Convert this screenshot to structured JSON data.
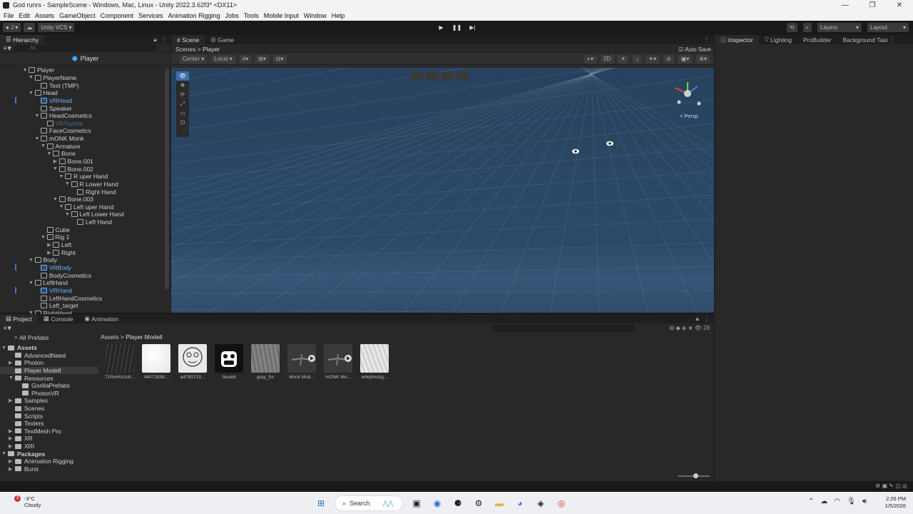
{
  "window": {
    "title": "God runrs - SampleScene - Windows, Mac, Linux - Unity 2022.3.62f3* <DX11>"
  },
  "menu": [
    "File",
    "Edit",
    "Assets",
    "GameObject",
    "Component",
    "Services",
    "Animation Rigging",
    "Jobs",
    "Tools",
    "Mobile Input",
    "Window",
    "Help"
  ],
  "toolbar": {
    "account": "J",
    "vcs": "Unity VCS",
    "layers": "Layers",
    "layout": "Layout"
  },
  "hierarchy": {
    "tab": "Hierarchy",
    "search_placeholder": "All",
    "context": "Player",
    "items": [
      {
        "label": "Player",
        "depth": 0,
        "arrow": "▼",
        "style": ""
      },
      {
        "label": "PlayerName",
        "depth": 1,
        "arrow": "▼",
        "style": ""
      },
      {
        "label": "Text (TMP)",
        "depth": 2,
        "arrow": "",
        "style": ""
      },
      {
        "label": "Head",
        "depth": 1,
        "arrow": "▼",
        "style": ""
      },
      {
        "label": "VRHead",
        "depth": 2,
        "arrow": "",
        "style": "blue"
      },
      {
        "label": "Speaker",
        "depth": 2,
        "arrow": "",
        "style": ""
      },
      {
        "label": "HeadCosmetics",
        "depth": 2,
        "arrow": "▼",
        "style": ""
      },
      {
        "label": "VRTopHat",
        "depth": 3,
        "arrow": "",
        "style": "dim"
      },
      {
        "label": "FaceCosmetics",
        "depth": 2,
        "arrow": "",
        "style": ""
      },
      {
        "label": "mONK Monk",
        "depth": 2,
        "arrow": "▼",
        "style": ""
      },
      {
        "label": "Armature",
        "depth": 3,
        "arrow": "▼",
        "style": ""
      },
      {
        "label": "Bone",
        "depth": 4,
        "arrow": "▼",
        "style": ""
      },
      {
        "label": "Bone.001",
        "depth": 5,
        "arrow": "▶",
        "style": ""
      },
      {
        "label": "Bone.002",
        "depth": 5,
        "arrow": "▼",
        "style": ""
      },
      {
        "label": "R uper Hand",
        "depth": 6,
        "arrow": "▼",
        "style": ""
      },
      {
        "label": "R Lower Hand",
        "depth": 7,
        "arrow": "▼",
        "style": ""
      },
      {
        "label": "Right Hand",
        "depth": 8,
        "arrow": "",
        "style": ""
      },
      {
        "label": "Bone.003",
        "depth": 5,
        "arrow": "▼",
        "style": ""
      },
      {
        "label": "Left uper Hand",
        "depth": 6,
        "arrow": "▼",
        "style": ""
      },
      {
        "label": "Left Lower Hand",
        "depth": 7,
        "arrow": "▼",
        "style": ""
      },
      {
        "label": "Left Hand",
        "depth": 8,
        "arrow": "",
        "style": ""
      },
      {
        "label": "Cube",
        "depth": 3,
        "arrow": "",
        "style": ""
      },
      {
        "label": "Rig 1",
        "depth": 3,
        "arrow": "▼",
        "style": ""
      },
      {
        "label": "Left",
        "depth": 4,
        "arrow": "▶",
        "style": ""
      },
      {
        "label": "Right",
        "depth": 4,
        "arrow": "▶",
        "style": ""
      },
      {
        "label": "Body",
        "depth": 1,
        "arrow": "▼",
        "style": ""
      },
      {
        "label": "VRBody",
        "depth": 2,
        "arrow": "",
        "style": "blue"
      },
      {
        "label": "BodyCosmetics",
        "depth": 2,
        "arrow": "",
        "style": ""
      },
      {
        "label": "LeftHand",
        "depth": 1,
        "arrow": "▼",
        "style": ""
      },
      {
        "label": "VRHand",
        "depth": 2,
        "arrow": "",
        "style": "blue"
      },
      {
        "label": "LeftHandCosmetics",
        "depth": 2,
        "arrow": "",
        "style": ""
      },
      {
        "label": "Left_target",
        "depth": 2,
        "arrow": "",
        "style": ""
      },
      {
        "label": "RightHand",
        "depth": 1,
        "arrow": "▼",
        "style": ""
      }
    ]
  },
  "scene": {
    "tabs": [
      "Scene",
      "Game"
    ],
    "breadcrumb": {
      "root": "Scenes",
      "current": "Player"
    },
    "auto_save": "Auto Save",
    "pivot": "Center",
    "space": "Local",
    "mode_2d": "2D",
    "persp": "< Persp"
  },
  "inspector": {
    "tabs": [
      "Inspector",
      "Lighting",
      "ProBuilder",
      "Background Tasi"
    ]
  },
  "project": {
    "tabs": [
      "Project",
      "Console",
      "Animation"
    ],
    "favorites": "All Prefabs",
    "count": "28",
    "breadcrumb": {
      "root": "Assets",
      "current": "Player Modell"
    },
    "tree": [
      {
        "label": "Assets",
        "depth": 0,
        "bold": true,
        "sel": false,
        "arrow": "▼"
      },
      {
        "label": "AdvancedNeed",
        "depth": 1,
        "bold": false,
        "sel": false,
        "arrow": ""
      },
      {
        "label": "Photon",
        "depth": 1,
        "bold": false,
        "sel": false,
        "arrow": "▶"
      },
      {
        "label": "Player Modell",
        "depth": 1,
        "bold": false,
        "sel": true,
        "arrow": ""
      },
      {
        "label": "Resources",
        "depth": 1,
        "bold": false,
        "sel": false,
        "arrow": "▼"
      },
      {
        "label": "GorillaPrefabs",
        "depth": 2,
        "bold": false,
        "sel": false,
        "arrow": ""
      },
      {
        "label": "PhotonVR",
        "depth": 2,
        "bold": false,
        "sel": false,
        "arrow": ""
      },
      {
        "label": "Samples",
        "depth": 1,
        "bold": false,
        "sel": false,
        "arrow": "▶"
      },
      {
        "label": "Scenes",
        "depth": 1,
        "bold": false,
        "sel": false,
        "arrow": ""
      },
      {
        "label": "Scripts",
        "depth": 1,
        "bold": false,
        "sel": false,
        "arrow": ""
      },
      {
        "label": "Texters",
        "depth": 1,
        "bold": false,
        "sel": false,
        "arrow": ""
      },
      {
        "label": "TextMesh Pro",
        "depth": 1,
        "bold": false,
        "sel": false,
        "arrow": "▶"
      },
      {
        "label": "XR",
        "depth": 1,
        "bold": false,
        "sel": false,
        "arrow": "▶"
      },
      {
        "label": "XRI",
        "depth": 1,
        "bold": false,
        "sel": false,
        "arrow": "▶"
      },
      {
        "label": "Packages",
        "depth": 0,
        "bold": true,
        "sel": false,
        "arrow": "▼"
      },
      {
        "label": "Animation Rigging",
        "depth": 1,
        "bold": false,
        "sel": false,
        "arrow": "▶"
      },
      {
        "label": "Burst",
        "depth": 1,
        "bold": false,
        "sel": false,
        "arrow": "▶"
      }
    ],
    "assets": [
      {
        "label": "71RwHzUo9...",
        "kind": "fur-dark"
      },
      {
        "label": "4407283d...",
        "kind": "white"
      },
      {
        "label": "a4790713...",
        "kind": "face"
      },
      {
        "label": "faceblt",
        "kind": "monkey"
      },
      {
        "label": "gray_fur",
        "kind": "fur-gray"
      },
      {
        "label": "Monk Mod...",
        "kind": "model"
      },
      {
        "label": "mONK Mo...",
        "kind": "model"
      },
      {
        "label": "w4ejhndsg...",
        "kind": "fur-light"
      }
    ]
  },
  "taskbar": {
    "weather_temp": "-3°C",
    "weather_text": "Cloudy",
    "badge": "3",
    "search": "Search",
    "time": "2:26 PM",
    "date": "1/5/2026"
  },
  "colors": {
    "accent": "#3d6da8",
    "viewport": "#2c4a68",
    "selection_blue": "#6ab0f7"
  }
}
